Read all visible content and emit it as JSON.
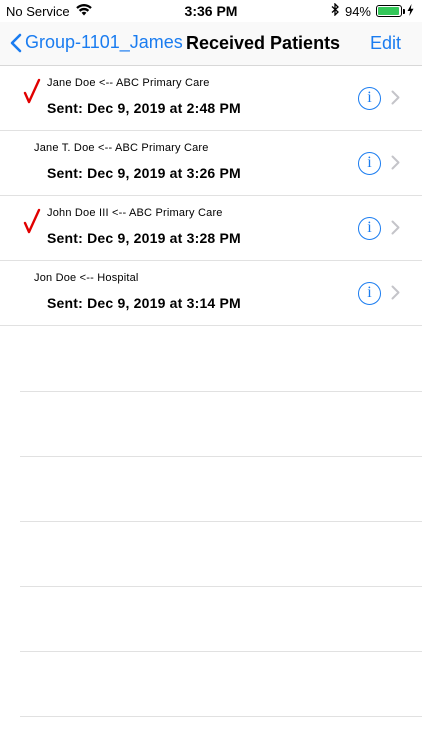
{
  "status_bar": {
    "carrier": "No Service",
    "time": "3:36 PM",
    "battery_percent": "94%",
    "battery_level": 0.94,
    "battery_color": "#34c759"
  },
  "nav": {
    "back_label": "Group-1101_James",
    "title": "Received Patients",
    "edit_label": "Edit",
    "accent_color": "#1a7cf0"
  },
  "patients": [
    {
      "title": "Jane Doe <-- ABC Primary Care",
      "sent": "Sent: Dec 9, 2019 at 2:48 PM",
      "checked": true
    },
    {
      "title": "Jane T. Doe <-- ABC Primary Care",
      "sent": "Sent: Dec 9, 2019 at 3:26 PM",
      "checked": false
    },
    {
      "title": "John Doe III <-- ABC Primary Care",
      "sent": "Sent: Dec 9, 2019 at 3:28 PM",
      "checked": true
    },
    {
      "title": "Jon Doe <-- Hospital",
      "sent": "Sent: Dec 9, 2019 at 3:14 PM",
      "checked": false
    }
  ],
  "icons": {
    "info": "info-icon",
    "chevron": "chevron-right-icon",
    "check": "checkmark-icon"
  }
}
